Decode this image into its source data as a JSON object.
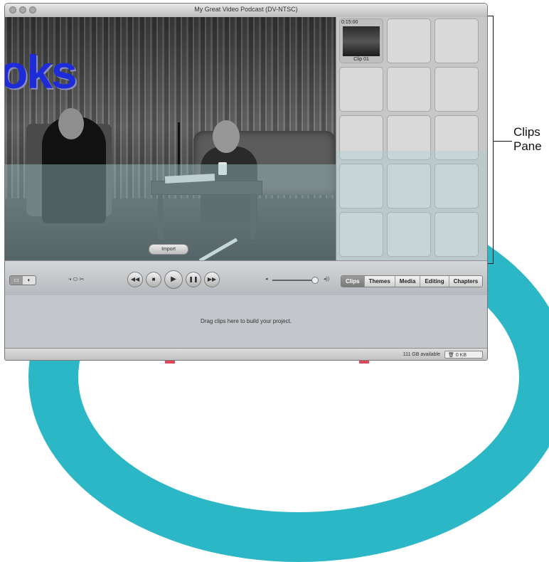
{
  "window": {
    "title": "My Great Video Podcast (DV-NTSC)"
  },
  "viewer": {
    "overlay_text": "oks",
    "import_label": "Import"
  },
  "clips_pane": {
    "clips": [
      {
        "name": "Clip 01",
        "duration": "0:15:00",
        "filled": true
      },
      {
        "filled": false
      },
      {
        "filled": false
      },
      {
        "filled": false
      },
      {
        "filled": false
      },
      {
        "filled": false
      },
      {
        "filled": false
      },
      {
        "filled": false
      },
      {
        "filled": false
      },
      {
        "filled": false
      },
      {
        "filled": false
      },
      {
        "filled": false
      },
      {
        "filled": false
      },
      {
        "filled": false
      },
      {
        "filled": false
      }
    ]
  },
  "controls": {
    "mode_toggle": [
      "▭",
      "◐"
    ],
    "camera_switch": "⋅▪ ⬭ ✂",
    "transport": {
      "rewind": "◀◀",
      "stop": "■",
      "play": "▶",
      "pause": "❚❚",
      "fast_forward": "▶▶"
    },
    "volume_low": "◂",
    "volume_high": "◂))",
    "volume_level": 0.92,
    "pane_tabs": [
      "Clips",
      "Themes",
      "Media",
      "Editing",
      "Chapters"
    ],
    "active_tab": "Clips"
  },
  "timeline": {
    "hint": "Drag clips here to build your project."
  },
  "statusbar": {
    "disk_space": "111 GB available",
    "trash": "0 KB"
  },
  "callout": {
    "line1": "Clips",
    "line2": "Pane"
  },
  "colors": {
    "watermark_teal": "#21b3c4",
    "watermark_red": "#e4455a",
    "overlay_blue": "#1d2bd9"
  }
}
